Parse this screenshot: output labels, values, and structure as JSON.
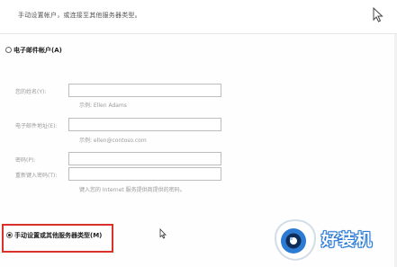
{
  "header": {
    "subtitle": "手动设置帐户，或连接至其他服务器类型。"
  },
  "options": {
    "email_account": {
      "label": "电子邮件帐户(A)",
      "selected": false
    },
    "manual_setup": {
      "label": "手动设置或其他服务器类型(M)",
      "selected": true
    }
  },
  "form": {
    "name": {
      "label": "您的姓名(Y):",
      "value": "",
      "hint": "示例: Ellen Adams"
    },
    "email": {
      "label": "电子邮件地址(E):",
      "value": "",
      "hint": "示例: ellen@contoso.com"
    },
    "password": {
      "label": "密码(P):",
      "value": ""
    },
    "password_confirm": {
      "label": "重新键入密码(T):",
      "value": "",
      "hint": "键入您的 Internet 服务提供商提供的密码。"
    }
  },
  "watermark": {
    "text": "好装机",
    "accent": "#2b7bd4"
  },
  "colors": {
    "highlight": "#d9322b"
  }
}
